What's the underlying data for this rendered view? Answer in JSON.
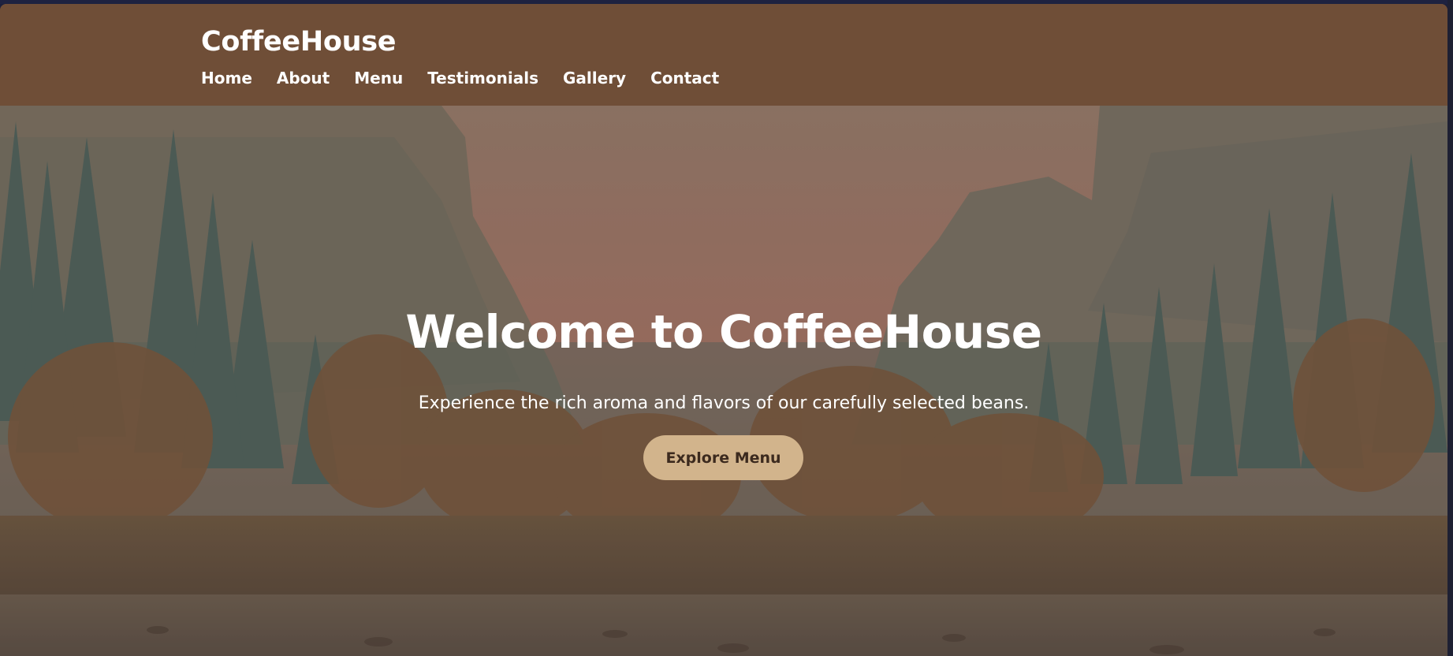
{
  "header": {
    "brand": "CoffeeHouse",
    "nav": [
      "Home",
      "About",
      "Menu",
      "Testimonials",
      "Gallery",
      "Contact"
    ]
  },
  "hero": {
    "title": "Welcome to CoffeeHouse",
    "subtitle": "Experience the rich aroma and flavors of our carefully selected beans.",
    "cta_label": "Explore Menu"
  },
  "colors": {
    "header_bg": "#6f4e37",
    "cta_bg": "#d2b48c",
    "cta_text": "#3c2a1e",
    "text": "#ffffff"
  }
}
